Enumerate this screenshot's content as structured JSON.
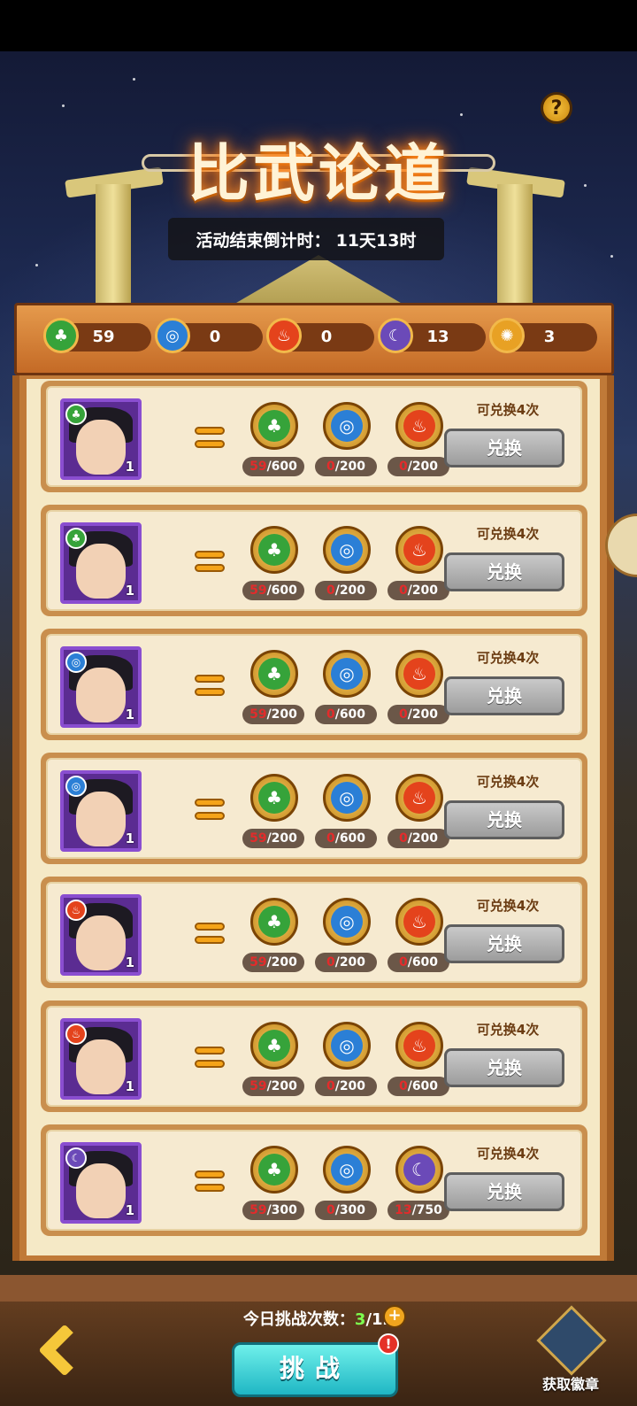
{
  "header": {
    "title": "比武论道",
    "countdown_label": "活动结束倒计时：",
    "countdown_value": "11天13时",
    "help_symbol": "?"
  },
  "resources": [
    {
      "element": "wood",
      "icon": "leaf-icon",
      "glyph": "♣",
      "color": "#36a33a",
      "value": "59"
    },
    {
      "element": "water",
      "icon": "water-swirl-icon",
      "glyph": "◎",
      "color": "#2b7fd6",
      "value": "0"
    },
    {
      "element": "fire",
      "icon": "flame-icon",
      "glyph": "♨",
      "color": "#e4431c",
      "value": "0"
    },
    {
      "element": "moon",
      "icon": "moon-icon",
      "glyph": "☾",
      "color": "#6b4ab8",
      "value": "13"
    },
    {
      "element": "earth",
      "icon": "sun-icon",
      "glyph": "✺",
      "color": "#e8a124",
      "value": "3"
    }
  ],
  "exchange_items": [
    {
      "hero_element_glyph": "♣",
      "hero_element_color": "#36a33a",
      "level": "1",
      "costs": [
        {
          "icon": "leaf-icon",
          "glyph": "♣",
          "color": "#36a33a",
          "have": "59",
          "need": "/600"
        },
        {
          "icon": "water-swirl-icon",
          "glyph": "◎",
          "color": "#2b7fd6",
          "have": "0",
          "need": "/200"
        },
        {
          "icon": "flame-icon",
          "glyph": "♨",
          "color": "#e4431c",
          "have": "0",
          "need": "/200"
        }
      ],
      "remaining": "可兑换4次",
      "button": "兑换"
    },
    {
      "hero_element_glyph": "♣",
      "hero_element_color": "#36a33a",
      "level": "1",
      "costs": [
        {
          "icon": "leaf-icon",
          "glyph": "♣",
          "color": "#36a33a",
          "have": "59",
          "need": "/600"
        },
        {
          "icon": "water-swirl-icon",
          "glyph": "◎",
          "color": "#2b7fd6",
          "have": "0",
          "need": "/200"
        },
        {
          "icon": "flame-icon",
          "glyph": "♨",
          "color": "#e4431c",
          "have": "0",
          "need": "/200"
        }
      ],
      "remaining": "可兑换4次",
      "button": "兑换"
    },
    {
      "hero_element_glyph": "◎",
      "hero_element_color": "#2b7fd6",
      "level": "1",
      "costs": [
        {
          "icon": "leaf-icon",
          "glyph": "♣",
          "color": "#36a33a",
          "have": "59",
          "need": "/200"
        },
        {
          "icon": "water-swirl-icon",
          "glyph": "◎",
          "color": "#2b7fd6",
          "have": "0",
          "need": "/600"
        },
        {
          "icon": "flame-icon",
          "glyph": "♨",
          "color": "#e4431c",
          "have": "0",
          "need": "/200"
        }
      ],
      "remaining": "可兑换4次",
      "button": "兑换"
    },
    {
      "hero_element_glyph": "◎",
      "hero_element_color": "#2b7fd6",
      "level": "1",
      "costs": [
        {
          "icon": "leaf-icon",
          "glyph": "♣",
          "color": "#36a33a",
          "have": "59",
          "need": "/200"
        },
        {
          "icon": "water-swirl-icon",
          "glyph": "◎",
          "color": "#2b7fd6",
          "have": "0",
          "need": "/600"
        },
        {
          "icon": "flame-icon",
          "glyph": "♨",
          "color": "#e4431c",
          "have": "0",
          "need": "/200"
        }
      ],
      "remaining": "可兑换4次",
      "button": "兑换"
    },
    {
      "hero_element_glyph": "♨",
      "hero_element_color": "#e4431c",
      "level": "1",
      "costs": [
        {
          "icon": "leaf-icon",
          "glyph": "♣",
          "color": "#36a33a",
          "have": "59",
          "need": "/200"
        },
        {
          "icon": "water-swirl-icon",
          "glyph": "◎",
          "color": "#2b7fd6",
          "have": "0",
          "need": "/200"
        },
        {
          "icon": "flame-icon",
          "glyph": "♨",
          "color": "#e4431c",
          "have": "0",
          "need": "/600"
        }
      ],
      "remaining": "可兑换4次",
      "button": "兑换"
    },
    {
      "hero_element_glyph": "♨",
      "hero_element_color": "#e4431c",
      "level": "1",
      "costs": [
        {
          "icon": "leaf-icon",
          "glyph": "♣",
          "color": "#36a33a",
          "have": "59",
          "need": "/200"
        },
        {
          "icon": "water-swirl-icon",
          "glyph": "◎",
          "color": "#2b7fd6",
          "have": "0",
          "need": "/200"
        },
        {
          "icon": "flame-icon",
          "glyph": "♨",
          "color": "#e4431c",
          "have": "0",
          "need": "/600"
        }
      ],
      "remaining": "可兑换4次",
      "button": "兑换"
    },
    {
      "hero_element_glyph": "☾",
      "hero_element_color": "#6b4ab8",
      "level": "1",
      "costs": [
        {
          "icon": "leaf-icon",
          "glyph": "♣",
          "color": "#36a33a",
          "have": "59",
          "need": "/300"
        },
        {
          "icon": "water-swirl-icon",
          "glyph": "◎",
          "color": "#2b7fd6",
          "have": "0",
          "need": "/300"
        },
        {
          "icon": "moon-icon",
          "glyph": "☾",
          "color": "#6b4ab8",
          "have": "13",
          "need": "/750"
        }
      ],
      "remaining": "可兑换4次",
      "button": "兑换"
    }
  ],
  "footer": {
    "challenge_label": "今日挑战次数：",
    "challenge_current": "3",
    "challenge_max": "/12",
    "plus_symbol": "+",
    "challenge_button": "挑战",
    "alert_symbol": "!",
    "badge_label": "获取徽章"
  }
}
